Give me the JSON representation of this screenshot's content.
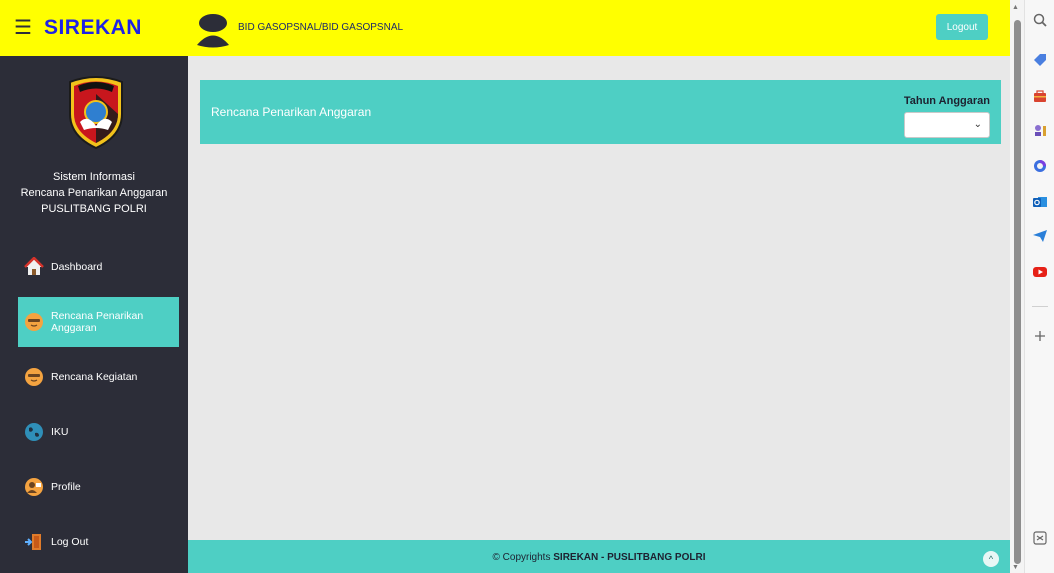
{
  "topbar": {
    "menu_icon": "hamburger-icon",
    "brand_prefix": "SI",
    "brand_rest": "REKAN",
    "user_name": "BID GASOPSNAL/BID GASOPSNAL",
    "logout_label": "Logout"
  },
  "sidebar": {
    "logo_icon": "litbang-emblem-icon",
    "info_line1": "Sistem Informasi",
    "info_line2": "Rencana Penarikan Anggaran",
    "info_line3": "PUSLITBANG POLRI",
    "items": [
      {
        "label": "Dashboard",
        "icon": "home-icon"
      },
      {
        "label": "Rencana Penarikan Anggaran",
        "icon": "face-icon",
        "active": true
      },
      {
        "label": "Rencana Kegiatan",
        "icon": "face-icon"
      },
      {
        "label": "IKU",
        "icon": "globe-icon"
      },
      {
        "label": "Profile",
        "icon": "profile-icon"
      },
      {
        "label": "Log Out",
        "icon": "door-icon"
      }
    ]
  },
  "main": {
    "title": "Rencana Penarikan Anggaran",
    "tahun_label": "Tahun Anggaran",
    "tahun_value": ""
  },
  "footer": {
    "prefix": "© Copyrights ",
    "bold": "SIREKAN - PUSLITBANG POLRI"
  },
  "colors": {
    "topbar": "#ffff00",
    "sidebar": "#2c2d38",
    "accent": "#4ecfc4",
    "content_bg": "#e8e8e8"
  }
}
